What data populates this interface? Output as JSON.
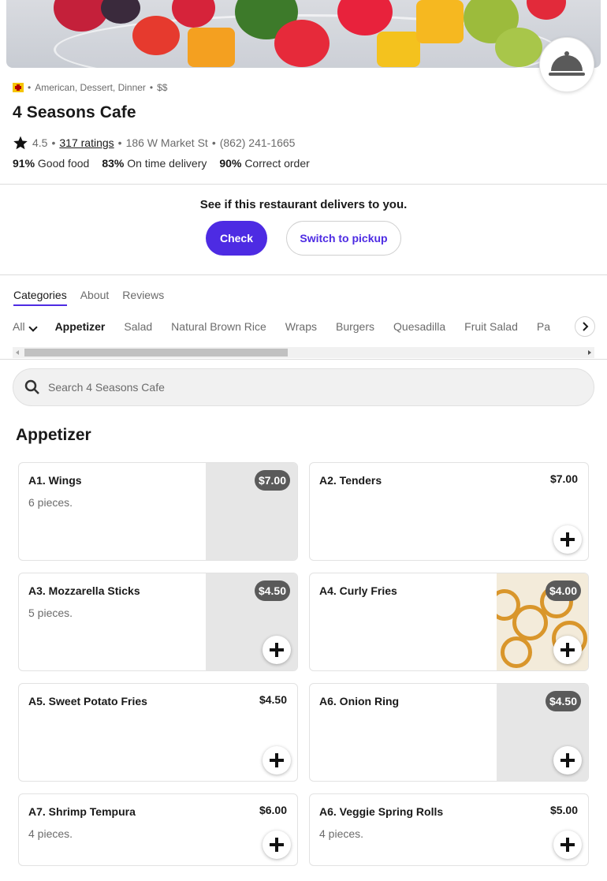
{
  "header": {
    "flag_icon": "flag-icon",
    "cuisines": "American, Dessert, Dinner",
    "price_level": "$$",
    "restaurant_name": "4 Seasons Cafe",
    "rating": "4.5",
    "ratings_count": "317 ratings",
    "address": "186 W Market St",
    "phone": "(862) 241-1665",
    "stats": [
      {
        "value": "91%",
        "label": "Good food"
      },
      {
        "value": "83%",
        "label": "On time delivery"
      },
      {
        "value": "90%",
        "label": "Correct order"
      }
    ]
  },
  "delivery": {
    "prompt": "See if this restaurant delivers to you.",
    "check_label": "Check",
    "pickup_label": "Switch to pickup",
    "accent_color": "#4d2be3"
  },
  "tabs": [
    {
      "label": "Categories",
      "active": true
    },
    {
      "label": "About",
      "active": false
    },
    {
      "label": "Reviews",
      "active": false
    }
  ],
  "categories": {
    "all_label": "All",
    "items": [
      "Appetizer",
      "Salad",
      "Natural Brown Rice",
      "Wraps",
      "Burgers",
      "Quesadilla",
      "Fruit Salad",
      "Pa"
    ],
    "selected": "Appetizer"
  },
  "search": {
    "placeholder": "Search 4 Seasons Cafe",
    "value": ""
  },
  "section": {
    "title": "Appetizer"
  },
  "menu_items": [
    {
      "name": "A1. Wings",
      "desc": "6 pieces.",
      "price": "$7.00"
    },
    {
      "name": "A2. Tenders",
      "desc": "",
      "price": "$7.00"
    },
    {
      "name": "A3. Mozzarella Sticks",
      "desc": "5 pieces.",
      "price": "$4.50"
    },
    {
      "name": "A4. Curly Fries",
      "desc": "",
      "price": "$4.00"
    },
    {
      "name": "A5. Sweet Potato Fries",
      "desc": "",
      "price": "$4.50"
    },
    {
      "name": "A6. Onion Ring",
      "desc": "",
      "price": "$4.50"
    },
    {
      "name": "A7. Shrimp Tempura",
      "desc": "4 pieces.",
      "price": "$6.00"
    },
    {
      "name": "A6. Veggie Spring Rolls",
      "desc": "4 pieces.",
      "price": "$5.00"
    }
  ]
}
